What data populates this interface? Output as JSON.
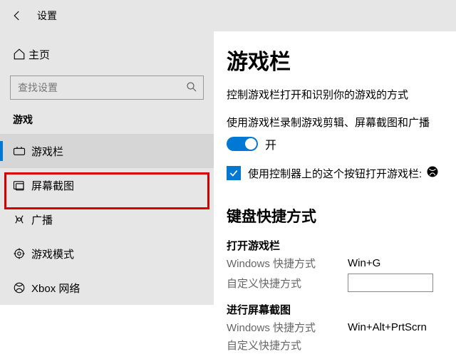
{
  "window": {
    "title": "设置"
  },
  "sidebar": {
    "home": "主页",
    "search_placeholder": "查找设置",
    "section": "游戏",
    "items": [
      {
        "label": "游戏栏"
      },
      {
        "label": "屏幕截图"
      },
      {
        "label": "广播"
      },
      {
        "label": "游戏模式"
      },
      {
        "label": "Xbox 网络"
      }
    ]
  },
  "content": {
    "heading": "游戏栏",
    "desc": "控制游戏栏打开和识别你的游戏的方式",
    "toggle_label": "使用游戏栏录制游戏剪辑、屏幕截图和广播",
    "toggle_state": "开",
    "checkbox_label": "使用控制器上的这个按钮打开游戏栏:",
    "shortcuts_heading": "键盘快捷方式",
    "group1": {
      "title": "打开游戏栏",
      "win_label": "Windows 快捷方式",
      "win_value": "Win+G",
      "custom_label": "自定义快捷方式",
      "custom_value": ""
    },
    "group2": {
      "title": "进行屏幕截图",
      "win_label": "Windows 快捷方式",
      "win_value": "Win+Alt+PrtScrn",
      "custom_label": "自定义快捷方式"
    }
  }
}
